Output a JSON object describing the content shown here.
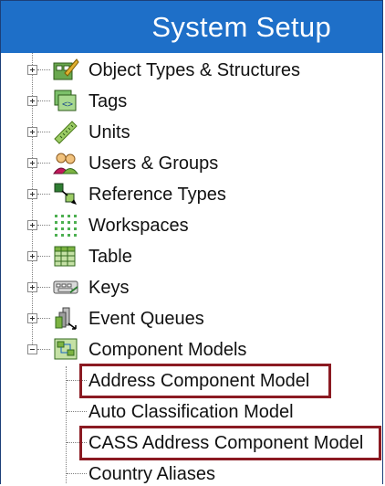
{
  "header": {
    "title": "System Setup"
  },
  "tree": {
    "items": [
      {
        "label": "Object Types & Structures",
        "icon": "object-types-icon",
        "expanded": false
      },
      {
        "label": "Tags",
        "icon": "tags-icon",
        "expanded": false
      },
      {
        "label": "Units",
        "icon": "ruler-icon",
        "expanded": false
      },
      {
        "label": "Users & Groups",
        "icon": "users-groups-icon",
        "expanded": false
      },
      {
        "label": "Reference Types",
        "icon": "reference-types-icon",
        "expanded": false
      },
      {
        "label": "Workspaces",
        "icon": "workspaces-icon",
        "expanded": false
      },
      {
        "label": "Table",
        "icon": "table-icon",
        "expanded": false
      },
      {
        "label": "Keys",
        "icon": "keys-icon",
        "expanded": false
      },
      {
        "label": "Event Queues",
        "icon": "event-queues-icon",
        "expanded": false
      },
      {
        "label": "Component Models",
        "icon": "component-models-icon",
        "expanded": true
      }
    ],
    "children": [
      {
        "label": "Address Component Model",
        "highlighted": true
      },
      {
        "label": "Auto Classification Model",
        "highlighted": false
      },
      {
        "label": "CASS Address Component Model",
        "highlighted": true
      },
      {
        "label": "Country Aliases",
        "highlighted": false
      }
    ]
  },
  "colors": {
    "header": "#1e6fc8",
    "highlight": "#8b1a22"
  }
}
